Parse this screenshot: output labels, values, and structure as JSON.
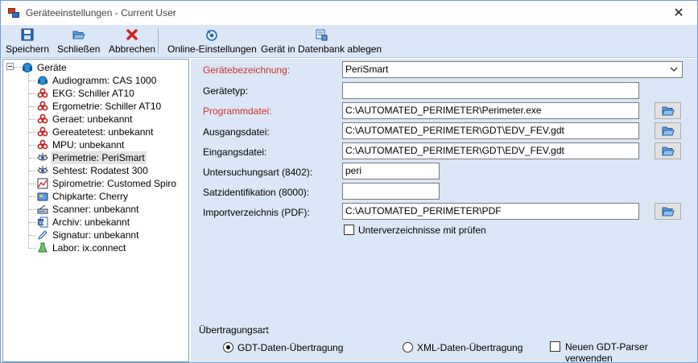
{
  "window": {
    "title": "Geräteeinstellungen - Current User",
    "close_glyph": "✕"
  },
  "toolbar": {
    "save_label": "Speichern",
    "close_label": "Schließen",
    "cancel_label": "Abbrechen",
    "online_label": "Online-Einstellungen",
    "db_label": "Gerät in Datenbank ablegen"
  },
  "tree": {
    "root_label": "Geräte",
    "items": [
      {
        "label": "Audiogramm: CAS 1000",
        "icon": "headphones-icon"
      },
      {
        "label": "EKG: Schiller AT10",
        "icon": "biohazard-icon"
      },
      {
        "label": "Ergometrie: Schiller AT10",
        "icon": "biohazard-icon"
      },
      {
        "label": "Geraet: unbekannt",
        "icon": "biohazard-icon"
      },
      {
        "label": "Gereatetest: unbekannt",
        "icon": "biohazard-icon"
      },
      {
        "label": "MPU: unbekannt",
        "icon": "biohazard-icon"
      },
      {
        "label": "Perimetrie: PeriSmart",
        "icon": "eye-icon"
      },
      {
        "label": "Sehtest: Rodatest 300",
        "icon": "eye-icon"
      },
      {
        "label": "Spirometrie: Customed Spiro",
        "icon": "chart-icon"
      },
      {
        "label": "Chipkarte: Cherry",
        "icon": "chipcard-icon"
      },
      {
        "label": "Scanner: unbekannt",
        "icon": "scanner-icon"
      },
      {
        "label": "Archiv: unbekannt",
        "icon": "word-document-icon"
      },
      {
        "label": "Signatur: unbekannt",
        "icon": "pen-icon"
      },
      {
        "label": "Labor: ix.connect",
        "icon": "flask-icon"
      }
    ],
    "selected_index": 6
  },
  "form": {
    "device_name_label": "Gerätebezeichnung:",
    "device_name_value": "PeriSmart",
    "device_type_label": "Gerätetyp:",
    "device_type_value": "",
    "program_file_label": "Programmdatei:",
    "program_file_value": "C:\\AUTOMATED_PERIMETER\\Perimeter.exe",
    "output_file_label": "Ausgangsdatei:",
    "output_file_value": "C:\\AUTOMATED_PERIMETER\\GDT\\EDV_FEV.gdt",
    "input_file_label": "Eingangsdatei:",
    "input_file_value": "C:\\AUTOMATED_PERIMETER\\GDT\\EDV_FEV.gdt",
    "exam_type_label": "Untersuchungsart (8402):",
    "exam_type_value": "peri",
    "record_id_label": "Satzidentifikation (8000):",
    "record_id_value": "",
    "import_dir_label": "Importverzeichnis (PDF):",
    "import_dir_value": "C:\\AUTOMATED_PERIMETER\\PDF",
    "subdirs_label": "Unterverzeichnisse mit prüfen",
    "subdirs_checked": false
  },
  "transfer": {
    "group_label": "Übertragungsart",
    "gdt_label": "GDT-Daten-Übertragung",
    "xml_label": "XML-Daten-Übertragung",
    "selected": "gdt",
    "parser_label": "Neuen GDT-Parser verwenden",
    "parser_checked": false
  },
  "colors": {
    "required_label": "#d42d2d",
    "panel_bg": "#dbe7f6",
    "window_border": "#6b9fd4"
  }
}
